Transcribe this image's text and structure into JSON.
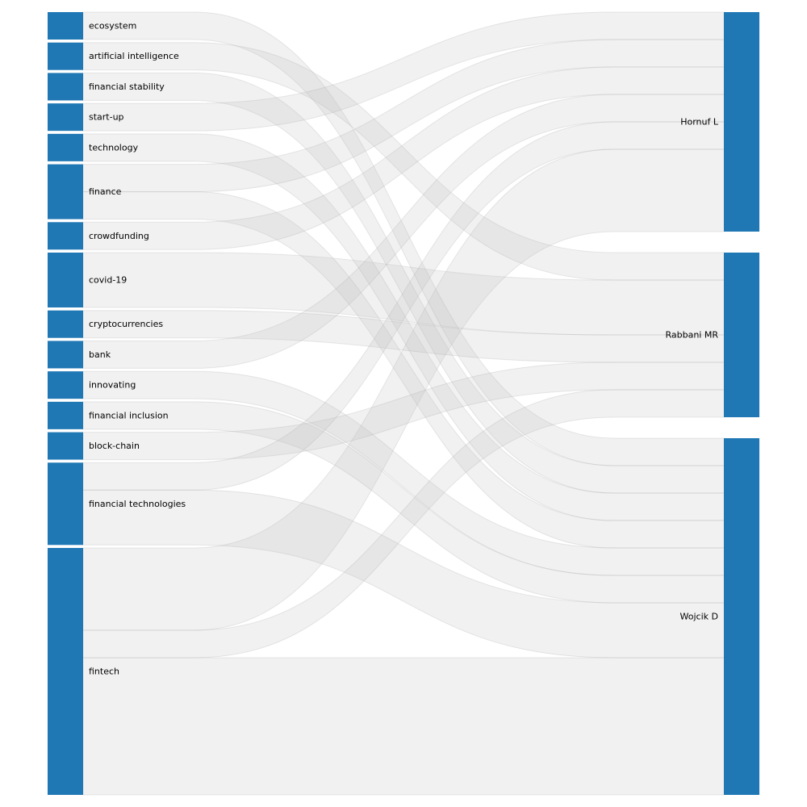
{
  "chart_data": {
    "type": "sankey",
    "title": "",
    "colors": {
      "node": "#1f77b4",
      "link_fill": "#bdbdbd",
      "link_stroke": "#a8a8a8",
      "background": "#ffffff"
    },
    "left_nodes": [
      "ecosystem",
      "artificial intelligence",
      "financial stability",
      "start-up",
      "technology",
      "finance",
      "crowdfunding",
      "covid-19",
      "cryptocurrencies",
      "bank",
      "innovating",
      "financial inclusion",
      "block-chain",
      "financial technologies",
      "fintech"
    ],
    "right_nodes": [
      "Hornuf L",
      "Rabbani MR",
      "Wojcik D"
    ],
    "links": [
      {
        "source": "ecosystem",
        "target": "Wojcik D",
        "value": 1
      },
      {
        "source": "artificial intelligence",
        "target": "Rabbani MR",
        "value": 1
      },
      {
        "source": "financial stability",
        "target": "Wojcik D",
        "value": 1
      },
      {
        "source": "start-up",
        "target": "Hornuf L",
        "value": 1
      },
      {
        "source": "technology",
        "target": "Wojcik D",
        "value": 1
      },
      {
        "source": "finance",
        "target": "Hornuf L",
        "value": 1
      },
      {
        "source": "finance",
        "target": "Wojcik D",
        "value": 1
      },
      {
        "source": "crowdfunding",
        "target": "Hornuf L",
        "value": 1
      },
      {
        "source": "covid-19",
        "target": "Rabbani MR",
        "value": 2
      },
      {
        "source": "cryptocurrencies",
        "target": "Rabbani MR",
        "value": 1
      },
      {
        "source": "bank",
        "target": "Hornuf L",
        "value": 1
      },
      {
        "source": "innovating",
        "target": "Wojcik D",
        "value": 1
      },
      {
        "source": "financial inclusion",
        "target": "Wojcik D",
        "value": 1
      },
      {
        "source": "block-chain",
        "target": "Rabbani MR",
        "value": 1
      },
      {
        "source": "financial technologies",
        "target": "Hornuf L",
        "value": 1
      },
      {
        "source": "financial technologies",
        "target": "Wojcik D",
        "value": 2
      },
      {
        "source": "fintech",
        "target": "Hornuf L",
        "value": 3
      },
      {
        "source": "fintech",
        "target": "Rabbani MR",
        "value": 1
      },
      {
        "source": "fintech",
        "target": "Wojcik D",
        "value": 5
      }
    ]
  }
}
